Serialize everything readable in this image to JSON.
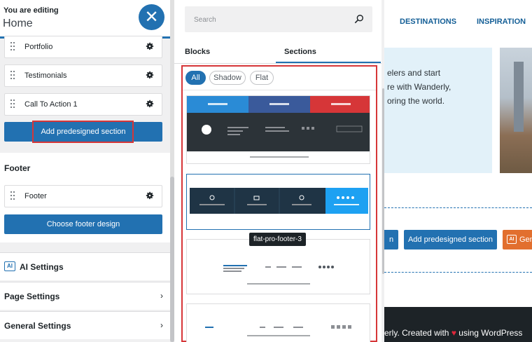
{
  "sidebar": {
    "editing_label": "You are editing",
    "page_name": "Home",
    "sections": [
      {
        "label": "Portfolio"
      },
      {
        "label": "Testimonials"
      },
      {
        "label": "Call To Action 1"
      }
    ],
    "add_section_label": "Add predesigned section",
    "footer_heading": "Footer",
    "footer_item": "Footer",
    "footer_design_label": "Choose footer design",
    "ai_settings": "AI Settings",
    "ai_icon_text": "AI",
    "page_settings": "Page Settings",
    "general_settings": "General Settings"
  },
  "panel": {
    "search_placeholder": "Search",
    "tabs": [
      "Blocks",
      "Sections"
    ],
    "active_tab": "Sections",
    "filters": [
      "All",
      "Shadow",
      "Flat"
    ],
    "active_filter": "All",
    "tooltip": "flat-pro-footer-3"
  },
  "preview": {
    "nav": [
      "DESTINATIONS",
      "INSPIRATION"
    ],
    "hero_lines": [
      "elers and start",
      "re with Wanderly,",
      "oring the world."
    ],
    "button_partial": "n",
    "add_section_label": "Add predesigned section",
    "generate_partial": "Gen",
    "ai_icon_text": "AI",
    "footer_credit_before": "erly. Created with ",
    "footer_credit_after": " using WordPress"
  },
  "colors": {
    "accent": "#2271b1",
    "highlight": "#d63638",
    "orange": "#e26f2e",
    "dark": "#1d2327"
  },
  "icons": [
    "close-icon",
    "drag-handle-icon",
    "gear-icon",
    "ai-icon",
    "chevron-right-icon",
    "search-icon",
    "heart-icon"
  ]
}
